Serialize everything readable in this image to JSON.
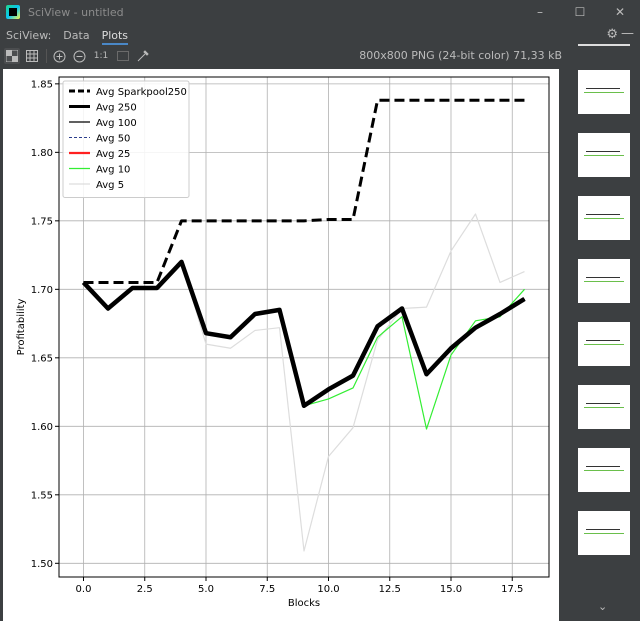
{
  "window": {
    "title": "SciView - untitled",
    "minimize": "–",
    "maximize": "☐",
    "close": "✕"
  },
  "menubar": {
    "label": "SciView:",
    "tabs": [
      {
        "label": "Data",
        "active": false
      },
      {
        "label": "Plots",
        "active": true
      }
    ],
    "settings_icon": "gear-icon",
    "hide_icon": "minus-icon"
  },
  "toolbar": {
    "zoom_actual_label": "1:1",
    "image_info": "800x800 PNG (24-bit color) 71,33 kB"
  },
  "chart_data": {
    "type": "line",
    "title": "",
    "xlabel": "Blocks",
    "ylabel": "Profitability",
    "xlim": [
      -1,
      19
    ],
    "ylim": [
      1.49,
      1.855
    ],
    "xticks": [
      "0.0",
      "2.5",
      "5.0",
      "7.5",
      "10.0",
      "12.5",
      "15.0",
      "17.5"
    ],
    "xtick_values": [
      0,
      2.5,
      5,
      7.5,
      10,
      12.5,
      15,
      17.5
    ],
    "yticks": [
      "1.50",
      "1.55",
      "1.60",
      "1.65",
      "1.70",
      "1.75",
      "1.80",
      "1.85"
    ],
    "ytick_values": [
      1.5,
      1.55,
      1.6,
      1.65,
      1.7,
      1.75,
      1.8,
      1.85
    ],
    "grid": true,
    "legend_position": "top-left",
    "x": [
      0,
      1,
      2,
      3,
      4,
      5,
      6,
      7,
      8,
      9,
      10,
      11,
      12,
      13,
      14,
      15,
      16,
      17,
      18
    ],
    "series": [
      {
        "name": "Avg Sparkpool250",
        "color": "#000000",
        "dash": "dashed",
        "values": [
          1.705,
          1.705,
          1.705,
          1.705,
          1.75,
          1.75,
          1.75,
          1.75,
          1.75,
          1.75,
          1.751,
          1.751,
          1.838,
          1.838,
          1.838,
          1.838,
          1.838,
          1.838,
          1.838
        ]
      },
      {
        "name": "Avg 250",
        "color": "#000000",
        "dash": "solid-thick",
        "values": [
          1.705,
          1.686,
          1.701,
          1.701,
          1.72,
          1.668,
          1.665,
          1.682,
          1.685,
          1.615,
          1.627,
          1.637,
          1.673,
          1.686,
          1.638,
          1.657,
          1.672,
          1.682,
          1.693
        ]
      },
      {
        "name": "Avg 100",
        "color": "#000000",
        "dash": "solid",
        "values": [
          1.705,
          1.686,
          1.701,
          1.701,
          1.72,
          1.668,
          1.665,
          1.682,
          1.685,
          1.615,
          1.627,
          1.637,
          1.673,
          1.686,
          1.638,
          1.657,
          1.672,
          1.682,
          1.693
        ]
      },
      {
        "name": "Avg 50",
        "color": "#2b3d8c",
        "dash": "dashed",
        "values": [
          1.705,
          1.686,
          1.701,
          1.701,
          1.72,
          1.668,
          1.665,
          1.682,
          1.685,
          1.615,
          1.627,
          1.637,
          1.673,
          1.686,
          1.638,
          1.657,
          1.672,
          1.682,
          1.693
        ]
      },
      {
        "name": "Avg 25",
        "color": "#ff2020",
        "dash": "solid",
        "values": [
          1.705,
          1.686,
          1.701,
          1.701,
          1.72,
          1.668,
          1.665,
          1.682,
          1.685,
          1.615,
          1.627,
          1.637,
          1.673,
          1.686,
          1.638,
          1.657,
          1.672,
          1.682,
          1.693
        ]
      },
      {
        "name": "Avg 10",
        "color": "#33ee33",
        "dash": "solid",
        "values": [
          1.705,
          1.686,
          1.701,
          1.701,
          1.72,
          1.668,
          1.665,
          1.682,
          1.685,
          1.615,
          1.62,
          1.628,
          1.665,
          1.68,
          1.598,
          1.652,
          1.677,
          1.68,
          1.7
        ]
      },
      {
        "name": "Avg 5",
        "color": "#dddddd",
        "dash": "solid",
        "values": [
          1.705,
          1.686,
          1.701,
          1.701,
          1.72,
          1.66,
          1.657,
          1.67,
          1.672,
          1.509,
          1.578,
          1.599,
          1.663,
          1.686,
          1.687,
          1.728,
          1.755,
          1.705,
          1.713
        ]
      }
    ]
  },
  "thumbnails": [
    {
      "label": "plot-1"
    },
    {
      "label": "plot-2"
    },
    {
      "label": "plot-3"
    },
    {
      "label": "plot-4"
    },
    {
      "label": "plot-5"
    },
    {
      "label": "plot-6"
    },
    {
      "label": "plot-7"
    },
    {
      "label": "plot-8"
    }
  ]
}
